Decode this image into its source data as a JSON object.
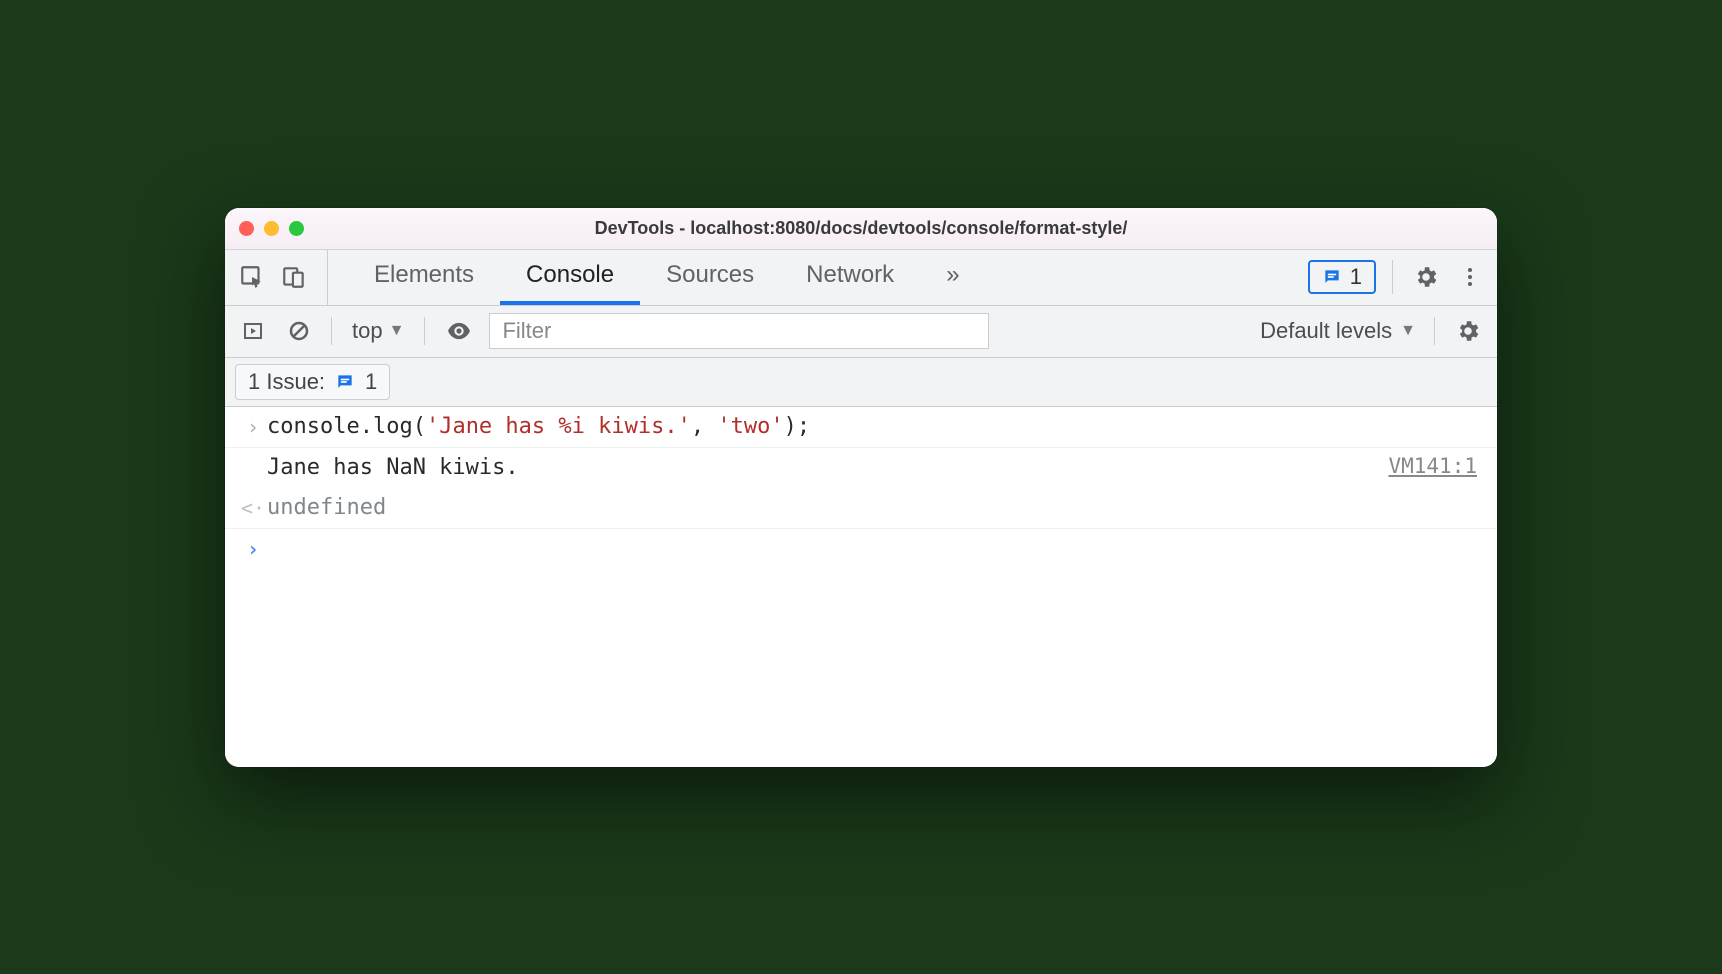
{
  "window": {
    "title": "DevTools - localhost:8080/docs/devtools/console/format-style/"
  },
  "tabs": {
    "elements": "Elements",
    "console": "Console",
    "sources": "Sources",
    "network": "Network"
  },
  "badge": {
    "count": "1"
  },
  "toolbar": {
    "context": "top",
    "filter_placeholder": "Filter",
    "levels": "Default levels"
  },
  "issues": {
    "label": "1 Issue:",
    "count": "1"
  },
  "console": {
    "input_pre": "console.log(",
    "input_str1": "'Jane has %i kiwis.'",
    "input_mid": ", ",
    "input_str2": "'two'",
    "input_post": ");",
    "output": "Jane has NaN kiwis.",
    "source": "VM141:1",
    "return": "undefined"
  }
}
